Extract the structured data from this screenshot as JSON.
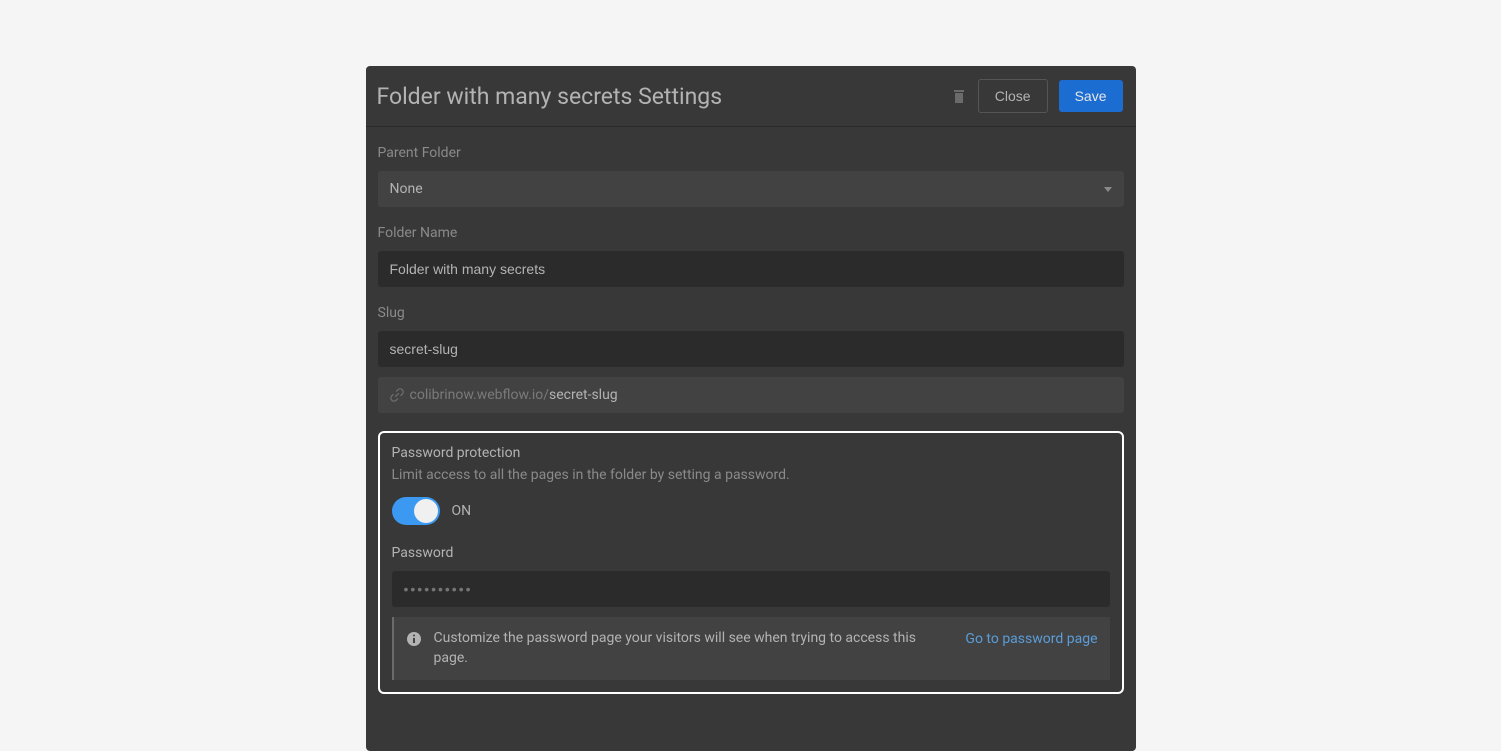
{
  "header": {
    "title": "Folder with many secrets Settings",
    "close_label": "Close",
    "save_label": "Save"
  },
  "form": {
    "parent_folder_label": "Parent Folder",
    "parent_folder_value": "None",
    "folder_name_label": "Folder Name",
    "folder_name_value": "Folder with many secrets",
    "slug_label": "Slug",
    "slug_value": "secret-slug",
    "url_base": "colibrinow.webflow.io/",
    "url_slug": "secret-slug"
  },
  "password_section": {
    "title": "Password protection",
    "description": "Limit access to all the pages in the folder by setting a password.",
    "toggle_state": "ON",
    "password_label": "Password",
    "password_placeholder": "••••••••••",
    "info_text": "Customize the password page your visitors will see when trying to access this page.",
    "info_link": "Go to password page"
  }
}
